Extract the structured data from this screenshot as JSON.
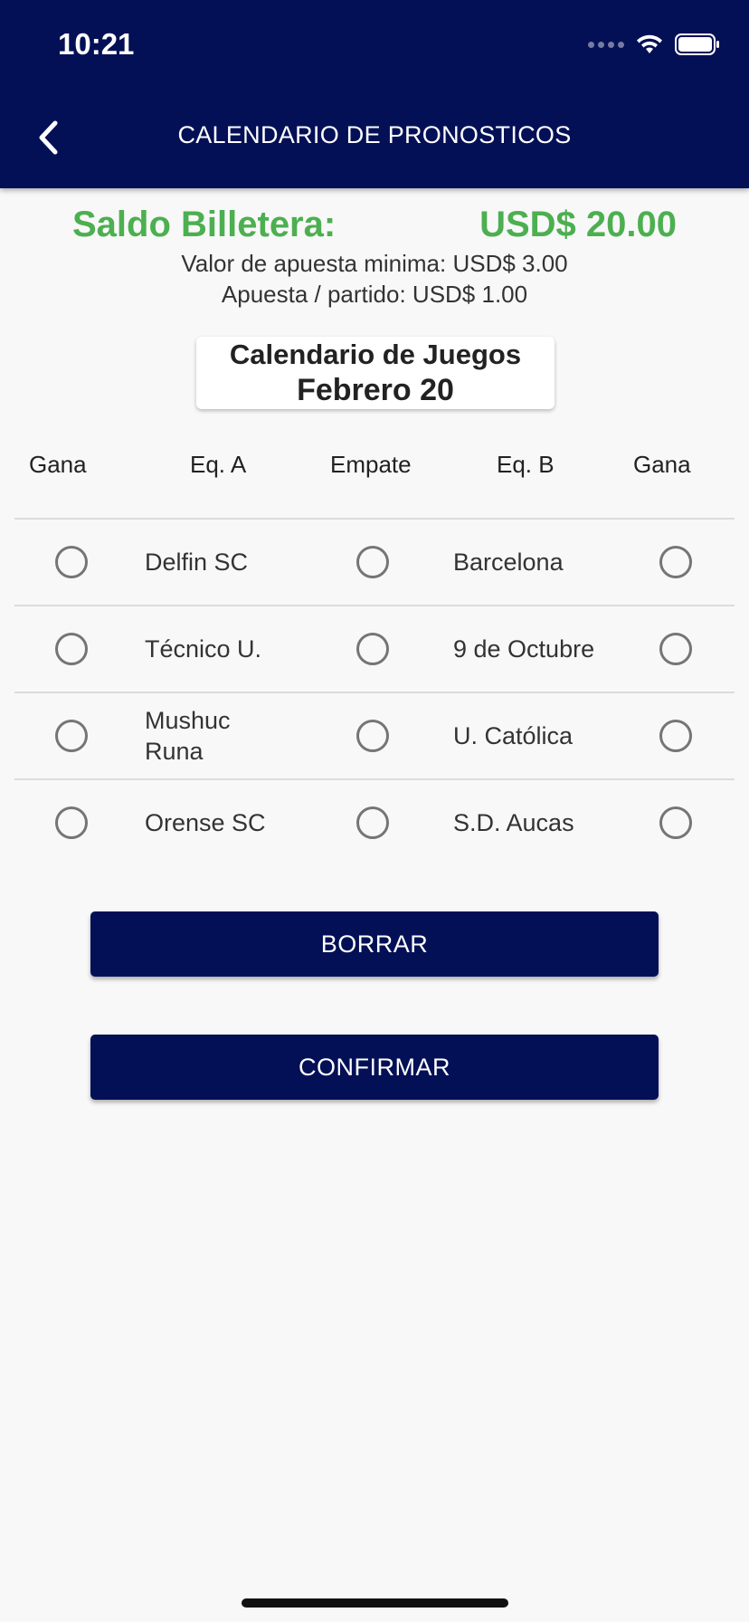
{
  "status_bar": {
    "time": "10:21"
  },
  "header": {
    "title": "CALENDARIO DE PRONOSTICOS"
  },
  "wallet": {
    "label": "Saldo Billetera:",
    "value": "USD$ 20.00",
    "min_bet": "Valor de apuesta minima: USD$ 3.00",
    "per_match": "Apuesta / partido: USD$ 1.00"
  },
  "calendar": {
    "title": "Calendario de Juegos",
    "date": "Febrero 20"
  },
  "table": {
    "headers": [
      "Gana",
      "Eq. A",
      "Empate",
      "Eq. B",
      "Gana"
    ],
    "rows": [
      {
        "team_a": "Delfin SC",
        "team_b": "Barcelona"
      },
      {
        "team_a": "Técnico U.",
        "team_b": "9 de Octubre"
      },
      {
        "team_a": "Mushuc Runa",
        "team_b": "U. Católica"
      },
      {
        "team_a": "Orense SC",
        "team_b": "S.D. Aucas"
      }
    ]
  },
  "buttons": {
    "clear": "BORRAR",
    "confirm": "CONFIRMAR"
  },
  "colors": {
    "primary": "#041056",
    "accent_green": "#4caf50",
    "background": "#f8f8f8"
  }
}
